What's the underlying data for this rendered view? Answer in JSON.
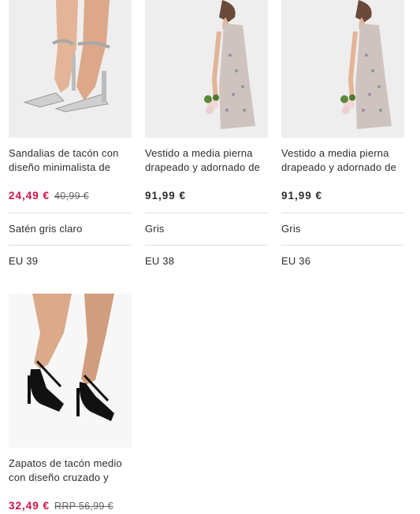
{
  "products": [
    {
      "title": "Sandalias de tacón con diseño minimalista de satén",
      "price": "24,49 €",
      "was_price": "40,99 €",
      "color": "Satén gris claro",
      "size": "EU 39"
    },
    {
      "title": "Vestido a media pierna drapeado y adornado de",
      "price": "91,99 €",
      "color": "Gris",
      "size": "EU 38"
    },
    {
      "title": "Vestido a media pierna drapeado y adornado de",
      "price": "91,99 €",
      "color": "Gris",
      "size": "EU 36"
    },
    {
      "title": "Zapatos de tacón medio con diseño cruzado y puntera en",
      "price": "32,49 €",
      "was_price": "RRP 56,99 €"
    }
  ],
  "colors": {
    "sale": "#d01345",
    "divider": "#dddddd",
    "image_bg": "#efefef"
  }
}
